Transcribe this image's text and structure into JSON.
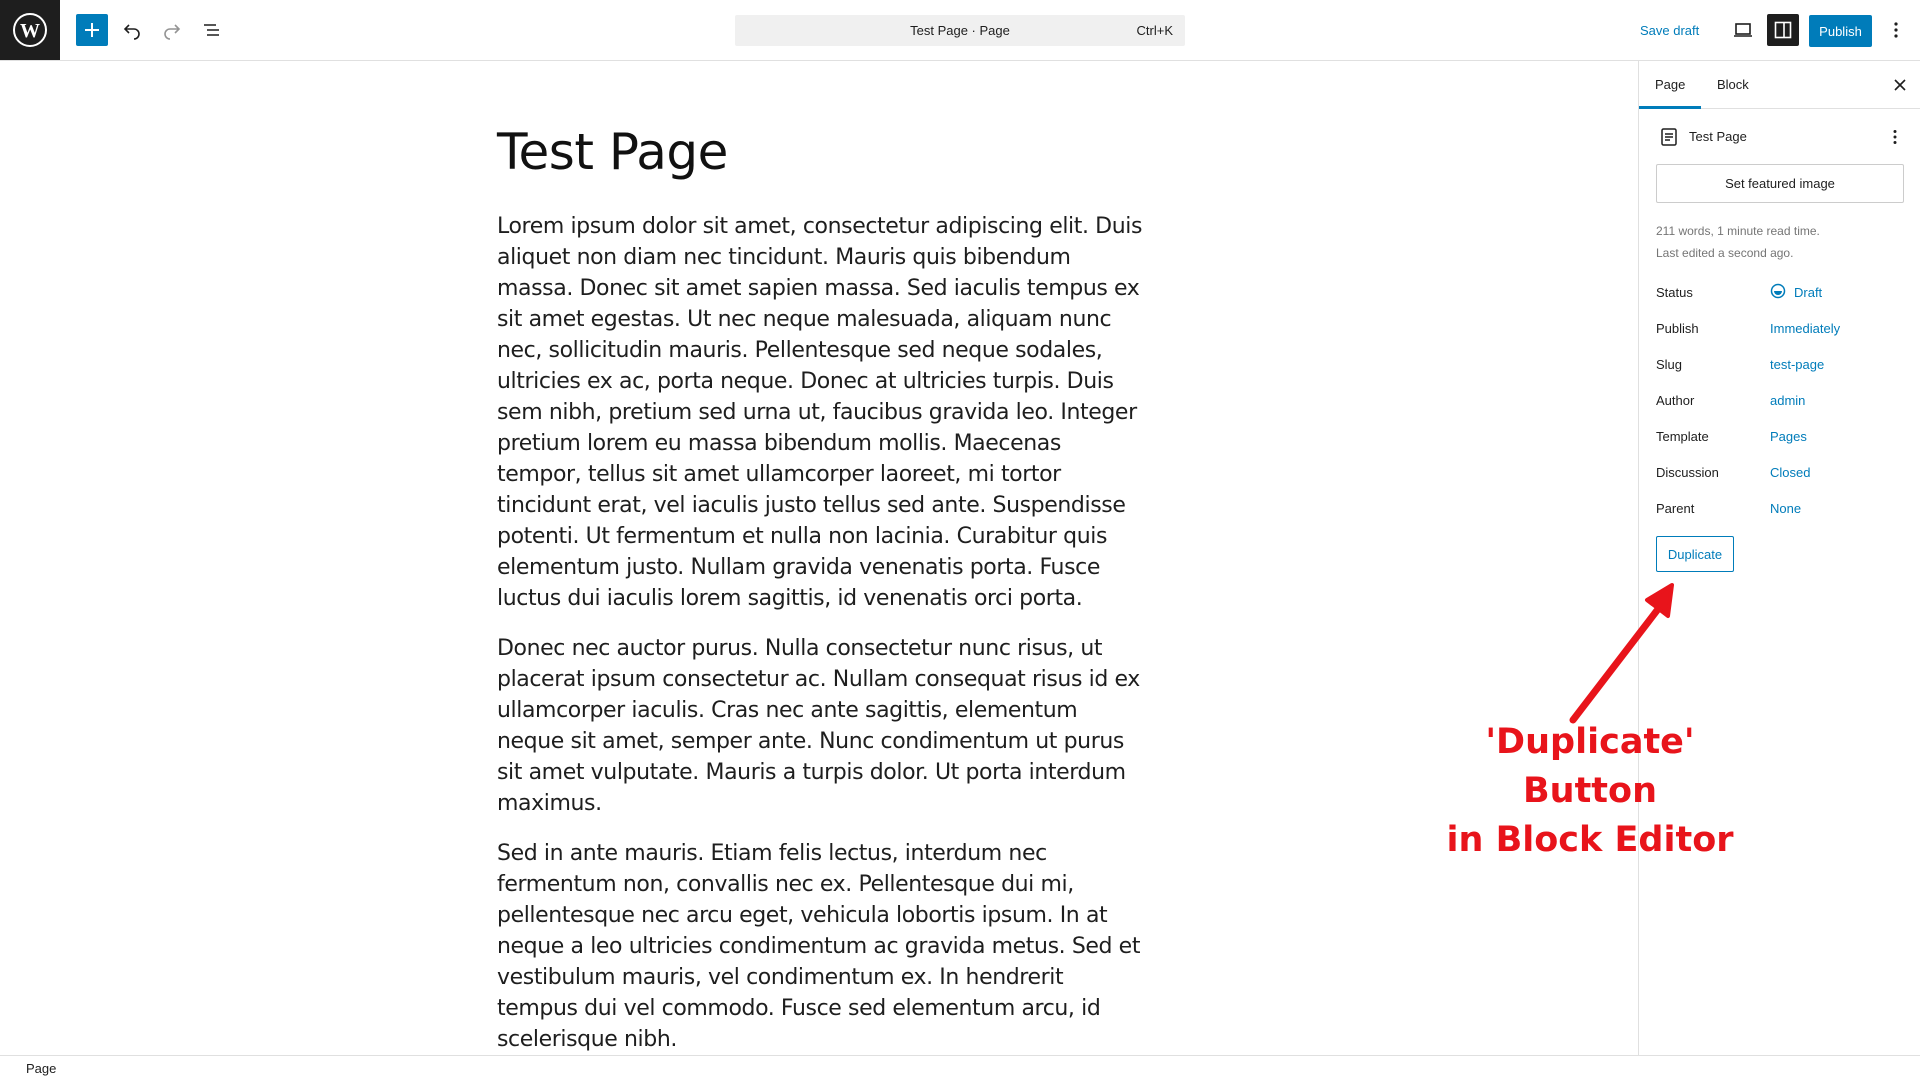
{
  "toolbar": {
    "command_title": "Test Page · Page",
    "command_shortcut": "Ctrl+K",
    "save_draft": "Save draft",
    "publish": "Publish"
  },
  "post": {
    "title": "Test Page",
    "paragraphs": [
      "Lorem ipsum dolor sit amet, consectetur adipiscing elit. Duis aliquet non diam nec tincidunt. Mauris quis bibendum massa. Donec sit amet sapien massa. Sed iaculis tempus ex sit amet egestas. Ut nec neque malesuada, aliquam nunc nec, sollicitudin mauris. Pellentesque sed neque sodales, ultricies ex ac, porta neque. Donec at ultricies turpis. Duis sem nibh, pretium sed urna ut, faucibus gravida leo. Integer pretium lorem eu massa bibendum mollis. Maecenas tempor, tellus sit amet ullamcorper laoreet, mi tortor tincidunt erat, vel iaculis justo tellus sed ante. Suspendisse potenti. Ut fermentum et nulla non lacinia. Curabitur quis elementum justo. Nullam gravida venenatis porta. Fusce luctus dui iaculis lorem sagittis, id venenatis orci porta.",
      "Donec nec auctor purus. Nulla consectetur nunc risus, ut placerat ipsum consectetur ac. Nullam consequat risus id ex ullamcorper iaculis. Cras nec ante sagittis, elementum neque sit amet, semper ante. Nunc condimentum ut purus sit amet vulputate. Mauris a turpis dolor. Ut porta interdum maximus.",
      "Sed in ante mauris. Etiam felis lectus, interdum nec fermentum non, convallis nec ex. Pellentesque dui mi, pellentesque nec arcu eget, vehicula lobortis ipsum. In at neque a leo ultricies condimentum ac gravida metus. Sed et vestibulum mauris, vel condimentum ex. In hendrerit tempus dui vel commodo. Fusce sed elementum arcu, id scelerisque nibh."
    ]
  },
  "sidebar": {
    "tabs": [
      {
        "label": "Page",
        "active": true
      },
      {
        "label": "Block",
        "active": false
      }
    ],
    "doc_title": "Test Page",
    "featured_image_button": "Set featured image",
    "meta_words": "211 words, 1 minute read time.",
    "meta_edited": "Last edited a second ago.",
    "properties": [
      {
        "label": "Status",
        "value": "Draft"
      },
      {
        "label": "Publish",
        "value": "Immediately"
      },
      {
        "label": "Slug",
        "value": "test-page"
      },
      {
        "label": "Author",
        "value": "admin"
      },
      {
        "label": "Template",
        "value": "Pages"
      },
      {
        "label": "Discussion",
        "value": "Closed"
      },
      {
        "label": "Parent",
        "value": "None"
      }
    ],
    "duplicate_button": "Duplicate"
  },
  "annotation": {
    "line1": "'Duplicate' Button",
    "line2": "in Block Editor",
    "color": "#e8141b"
  },
  "footer": {
    "breadcrumb": "Page"
  },
  "colors": {
    "accent": "#007cba",
    "dark": "#1e1e1e"
  },
  "icons": [
    "wordpress-logo-icon",
    "plus-icon",
    "undo-icon",
    "redo-icon",
    "list-view-icon",
    "desktop-preview-icon",
    "sidebar-settings-icon",
    "more-vertical-icon",
    "close-icon",
    "page-icon",
    "draft-status-icon",
    "arrow-icon"
  ]
}
